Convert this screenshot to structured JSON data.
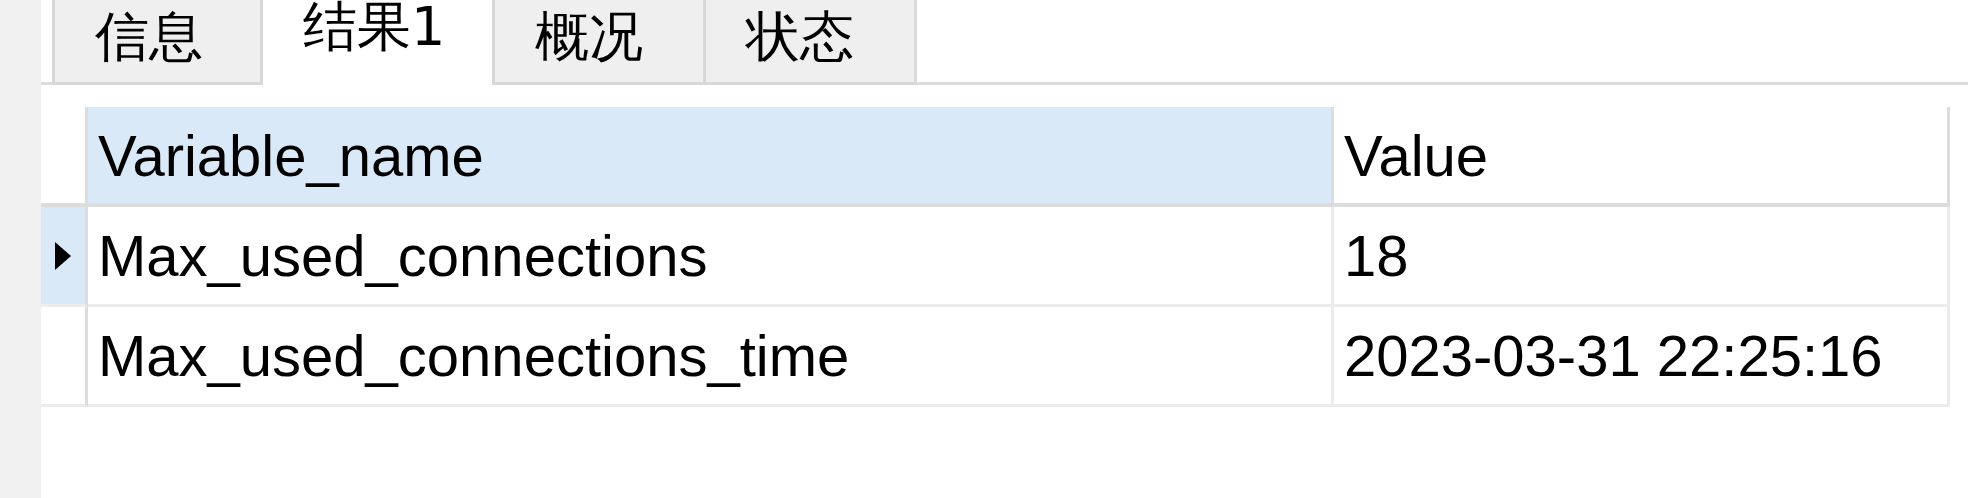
{
  "tabs": [
    {
      "label": "信息",
      "selected": false
    },
    {
      "label": "结果1",
      "selected": true
    },
    {
      "label": "概况",
      "selected": false
    },
    {
      "label": "状态",
      "selected": false
    }
  ],
  "table": {
    "columns": [
      {
        "label": "Variable_name",
        "selected": true
      },
      {
        "label": "Value",
        "selected": false
      }
    ],
    "rows": [
      {
        "cells": [
          "Max_used_connections",
          "18"
        ],
        "selected": true
      },
      {
        "cells": [
          "Max_used_connections_time",
          "2023-03-31 22:25:16"
        ],
        "selected": false
      }
    ]
  }
}
